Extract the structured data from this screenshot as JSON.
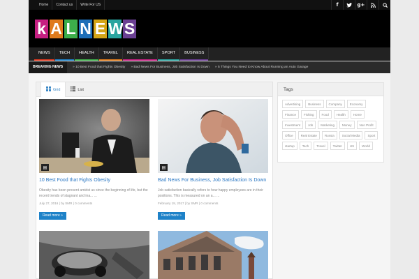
{
  "colors": {
    "accent": "#1e82c8",
    "logo": [
      "#c61f82",
      "#e07b1c",
      "#3dae4a",
      "#1e6fb8",
      "#d4a517",
      "#2aa5a0",
      "#6a3f93"
    ],
    "nav_bars": [
      "#e13a1f",
      "#1e82c8",
      "#3dae4a",
      "#e07b1c",
      "#c61f82",
      "#2aa5a0",
      "#6a3f93"
    ]
  },
  "topnav": [
    "Home",
    "Contact us",
    "Write For US"
  ],
  "social_icons": [
    "facebook-icon",
    "twitter-icon",
    "google-plus-icon",
    "rss-icon",
    "search-icon"
  ],
  "logo_letters": [
    "k",
    "A",
    "L",
    "N",
    "E",
    "W",
    "S"
  ],
  "mainnav": [
    "NEWS",
    "TECH",
    "HEALTH",
    "TRAVEL",
    "REAL ESTATE",
    "SPORT",
    "BUSINESS"
  ],
  "breaking": {
    "label": "BREAKING NEWS",
    "items": [
      "10 Best Food that Fights Obesity",
      "Bad News For Business, Job Satisfaction Is Down",
      "5 Things You Need to Know About Running an Auto Garage"
    ]
  },
  "tabs": {
    "grid": "Grid",
    "list": "List"
  },
  "posts": [
    {
      "title": "10 Best Food that Fights Obesity",
      "excerpt": "Obesity has been present amidst us since the beginning of life, but the recent trends of stagnant and ina... ...",
      "meta": "July 27, 2016 | by SMR | 0 comments",
      "more": "Read more"
    },
    {
      "title": "Bad News For Business, Job Satisfaction Is Down",
      "excerpt": "Job satisfaction basically refers to how happy employees are in their positions. This is measured on an a... ...",
      "meta": "February 18, 2017 | by SMR | 0 comments",
      "more": "Read more"
    }
  ],
  "tags": {
    "title": "Tags",
    "items": [
      "Advertising",
      "Business",
      "Company",
      "Economy",
      "Finance",
      "Fishing",
      "Food",
      "Health",
      "Home",
      "Investment",
      "Job",
      "Marketing",
      "Money",
      "Non Profit",
      "Office",
      "Real Estate",
      "Russia",
      "Social Media",
      "Sport",
      "startup",
      "Tech",
      "Travel",
      "Twitter",
      "US",
      "World"
    ]
  }
}
